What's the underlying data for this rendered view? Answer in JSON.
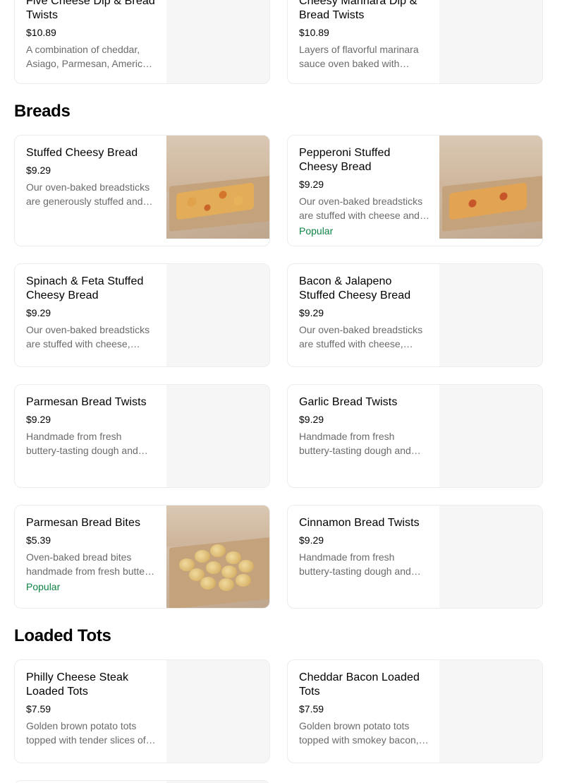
{
  "sections": {
    "breads_title": "Breads",
    "loaded_tots_title": "Loaded Tots"
  },
  "items": {
    "five_cheese": {
      "name": "Five Cheese Dip & Bread Twists",
      "price": "$10.89",
      "desc": "A combination of cheddar, Asiago, Parmesan, American, and provolone cheeses"
    },
    "cheesy_marinara": {
      "name": "Cheesy Marinara Dip & Bread Twists",
      "price": "$10.89",
      "desc": "Layers of flavorful marinara sauce oven baked with cheese"
    },
    "stuffed_cheesy": {
      "name": "Stuffed Cheesy Bread",
      "price": "$9.29",
      "desc": "Our oven-baked breadsticks are generously stuffed and covered with cheese"
    },
    "pepperoni_stuffed": {
      "name": "Pepperoni Stuffed Cheesy Bread",
      "price": "$9.29",
      "desc": "Our oven-baked breadsticks are stuffed with cheese and pepperoni",
      "badge": "Popular"
    },
    "spinach_feta": {
      "name": "Spinach & Feta Stuffed Cheesy Bread",
      "price": "$9.29",
      "desc": "Our oven-baked breadsticks are stuffed with cheese, spinach and feta"
    },
    "bacon_jalapeno": {
      "name": "Bacon & Jalapeno Stuffed Cheesy Bread",
      "price": "$9.29",
      "desc": "Our oven-baked breadsticks are stuffed with cheese, bacon and jalapenos"
    },
    "parmesan_twists": {
      "name": "Parmesan Bread Twists",
      "price": "$9.29",
      "desc": "Handmade from fresh buttery-tasting dough and baked to a golden brown"
    },
    "garlic_twists": {
      "name": "Garlic Bread Twists",
      "price": "$9.29",
      "desc": "Handmade from fresh buttery-tasting dough and baked to a golden brown"
    },
    "parmesan_bites": {
      "name": "Parmesan Bread Bites",
      "price": "$5.39",
      "desc": "Oven-baked bread bites handmade from fresh buttery-tasting dough",
      "badge": "Popular"
    },
    "cinnamon_twists": {
      "name": "Cinnamon Bread Twists",
      "price": "$9.29",
      "desc": "Handmade from fresh buttery-tasting dough and baked to a golden brown"
    },
    "philly_tots": {
      "name": "Philly Cheese Steak Loaded Tots",
      "price": "$7.59",
      "desc": "Golden brown potato tots topped with tender slices of steak"
    },
    "cheddar_bacon_tots": {
      "name": "Cheddar Bacon Loaded Tots",
      "price": "$7.59",
      "desc": "Golden brown potato tots topped with smokey bacon, cheddar cheese"
    }
  },
  "colors": {
    "popular_badge": "#0e8345",
    "description_text": "#6b6b6b",
    "placeholder_bg": "#f6f6f6"
  }
}
